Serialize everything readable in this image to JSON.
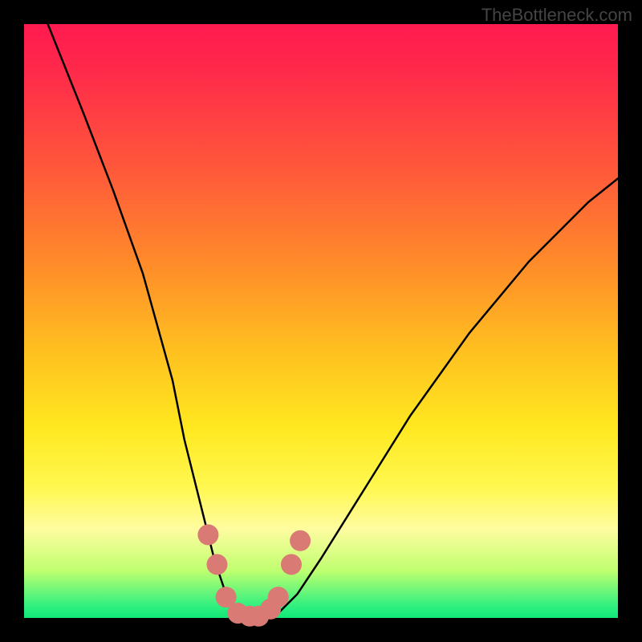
{
  "watermark": "TheBottleneck.com",
  "chart_data": {
    "type": "line",
    "title": "",
    "xlabel": "",
    "ylabel": "",
    "xlim": [
      0,
      100
    ],
    "ylim": [
      0,
      100
    ],
    "series": [
      {
        "name": "bottleneck-curve",
        "x": [
          4,
          10,
          15,
          20,
          25,
          27,
          30,
          32,
          34,
          36,
          38,
          40,
          43,
          46,
          50,
          55,
          60,
          65,
          70,
          75,
          80,
          85,
          90,
          95,
          100
        ],
        "y": [
          100,
          85,
          72,
          58,
          40,
          30,
          18,
          10,
          4,
          1,
          0,
          0,
          1,
          4,
          10,
          18,
          26,
          34,
          41,
          48,
          54,
          60,
          65,
          70,
          74
        ]
      }
    ],
    "markers": {
      "name": "highlight-points",
      "color": "#d97a74",
      "x": [
        31,
        32.5,
        34,
        36,
        38,
        39.5,
        41.5,
        42.8,
        45.0,
        46.5
      ],
      "y": [
        14,
        9,
        3.5,
        0.8,
        0.3,
        0.3,
        1.5,
        3.5,
        9.0,
        13.0
      ]
    }
  }
}
